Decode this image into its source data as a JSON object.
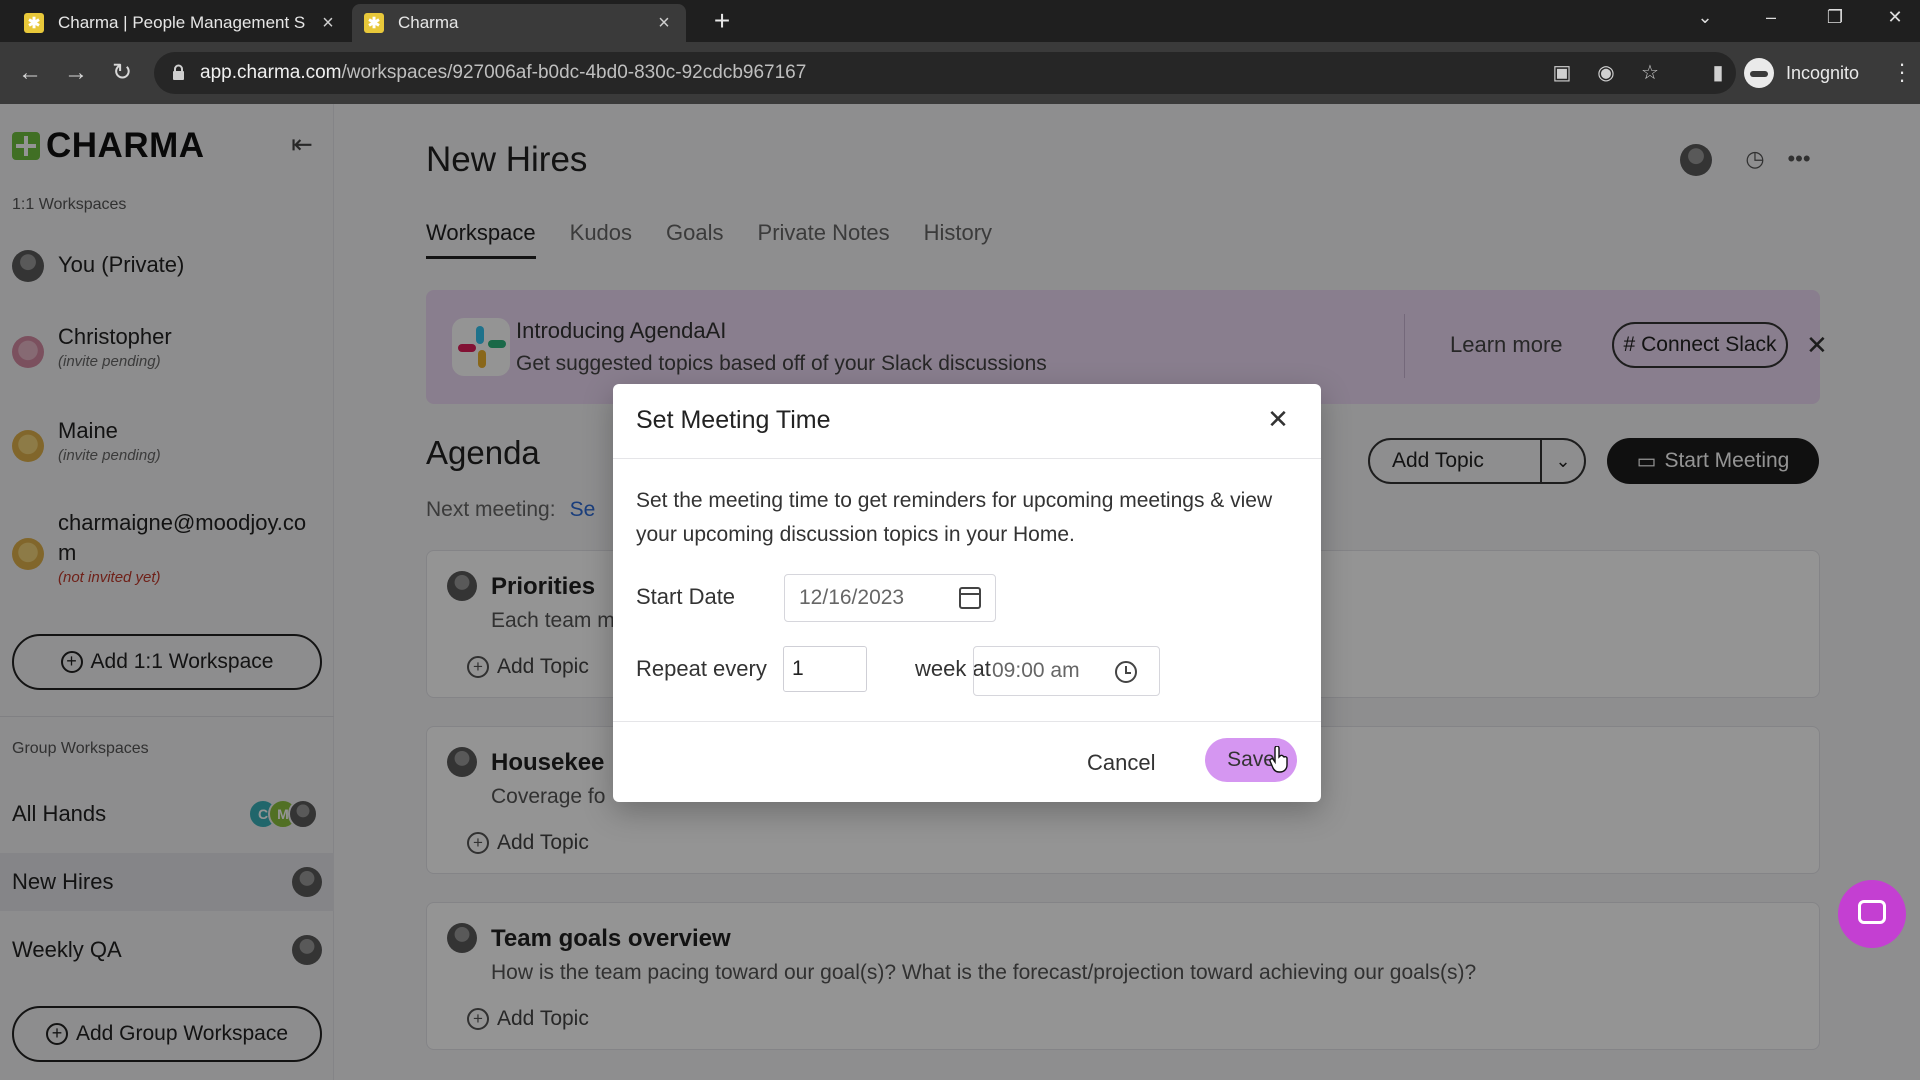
{
  "browser": {
    "tabs": [
      {
        "title": "Charma | People Management S",
        "active": false
      },
      {
        "title": "Charma",
        "active": true
      }
    ],
    "url_host": "app.charma.com",
    "url_path": "/workspaces/927006af-b0dc-4bd0-830c-92cdcb967167",
    "profile_label": "Incognito"
  },
  "sidebar": {
    "logo_text": "CHARMA",
    "one_on_one_label": "1:1 Workspaces",
    "workspaces": [
      {
        "name": "You (Private)",
        "sub": ""
      },
      {
        "name": "Christopher",
        "sub": "(invite pending)"
      },
      {
        "name": "Maine",
        "sub": "(invite pending)"
      },
      {
        "name": "charmaigne@moodjoy.co",
        "name2": "m",
        "sub": "(not invited yet)"
      }
    ],
    "add_workspace_label": "Add 1:1 Workspace",
    "group_label": "Group Workspaces",
    "groups": [
      {
        "name": "All Hands",
        "initials": [
          "C",
          "M"
        ]
      },
      {
        "name": "New Hires"
      },
      {
        "name": "Weekly QA"
      }
    ],
    "add_group_label": "Add Group Workspace"
  },
  "main": {
    "title": "New Hires",
    "tabs": [
      "Workspace",
      "Kudos",
      "Goals",
      "Private Notes",
      "History"
    ],
    "banner": {
      "title": "Introducing AgendaAI",
      "subtitle": "Get suggested topics based off of your Slack discussions",
      "learn_more": "Learn more",
      "connect": "Connect Slack"
    },
    "agenda_title": "Agenda",
    "next_meeting_label": "Next meeting:",
    "next_meeting_link": "Se",
    "add_topic_label": "Add Topic",
    "start_meeting_label": "Start Meeting",
    "cards": [
      {
        "title": "Priorities",
        "desc": "Each team m",
        "add": "Add Topic"
      },
      {
        "title": "Housekee",
        "desc": "Coverage fo",
        "add": "Add Topic"
      },
      {
        "title": "Team goals overview",
        "desc": "How is the team pacing toward our goal(s)? What is the forecast/projection toward achieving our goals(s)?",
        "add": "Add Topic"
      }
    ]
  },
  "modal": {
    "title": "Set Meeting Time",
    "description": "Set the meeting time to get reminders for upcoming meetings & view your upcoming discussion topics in your Home.",
    "start_date_label": "Start Date",
    "start_date_value": "12/16/2023",
    "repeat_label": "Repeat every",
    "repeat_value": "1",
    "week_at_label": "week at",
    "time_value": "09:00 am",
    "cancel_label": "Cancel",
    "save_label": "Save"
  },
  "colors": {
    "accent_purple": "#d596f1",
    "banner_bg": "#ecd9f4",
    "chat_fab": "#c43fd2",
    "logo_green": "#6fbf3f"
  }
}
